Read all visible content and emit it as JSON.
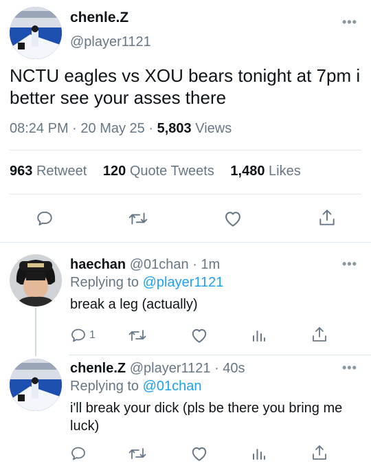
{
  "tweet": {
    "author_name": "chenle.Z",
    "author_handle": "@player1121",
    "text": "NCTU eagles vs XOU bears tonight at 7pm i better see your asses there",
    "time": "08:24 PM",
    "date": "20 May 25",
    "separator": "·",
    "views_count": "5,803",
    "views_label": "Views",
    "retweet_count": "963",
    "retweet_label": "Retweet",
    "quote_count": "120",
    "quote_label": "Quote Tweets",
    "likes_count": "1,480",
    "likes_label": "Likes",
    "more": "•••"
  },
  "replies": [
    {
      "name": "haechan",
      "handle": "@01chan",
      "time": "· 1m",
      "replying_prefix": "Replying to",
      "replying_to": "@player1121",
      "text": "break a leg (actually)",
      "reply_count": "1",
      "more": "•••"
    },
    {
      "name": "chenle.Z",
      "handle": "@player1121",
      "time": "· 40s",
      "replying_prefix": "Replying to",
      "replying_to": "@01chan",
      "text": "i'll break your dick (pls be there you bring me luck)",
      "more": "•••"
    }
  ],
  "colors": {
    "accent": "#1da1f2",
    "muted": "#657786",
    "divider": "#e1e8ed",
    "text": "#0f1419"
  },
  "icons": [
    "reply-icon",
    "retweet-icon",
    "like-icon",
    "share-icon",
    "analytics-icon",
    "more-icon"
  ]
}
